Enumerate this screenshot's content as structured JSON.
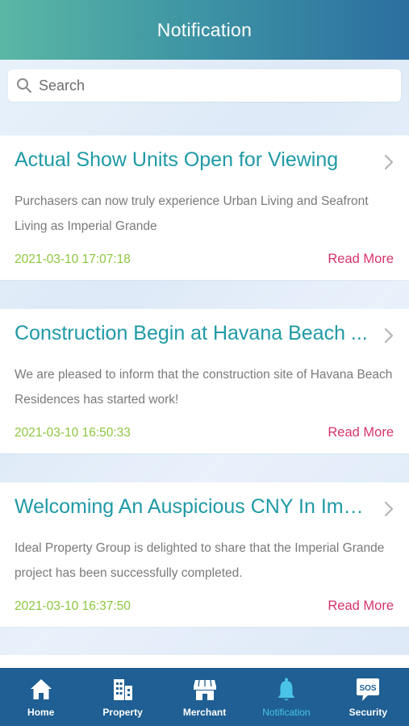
{
  "header": {
    "title": "Notification"
  },
  "search": {
    "placeholder": "Search",
    "icon": "search-icon"
  },
  "notifications": [
    {
      "title": "Actual Show Units Open for Viewing",
      "summary": "Purchasers can now truly experience Urban Living and Seafront Living as Imperial Grande",
      "date": "2021-03-10 17:07:18",
      "action": "Read More"
    },
    {
      "title": "Construction Begin at Havana Beach ...",
      "summary": "We are pleased to inform that the construction site of Havana Beach Residences has started work!",
      "date": "2021-03-10 16:50:33",
      "action": "Read More"
    },
    {
      "title": "Welcoming An Auspicious CNY In Imp...",
      "summary": "Ideal Property Group is delighted to share that the Imperial Grande project has been successfully completed.",
      "date": "2021-03-10 16:37:50",
      "action": "Read More"
    }
  ],
  "tabbar": {
    "items": [
      {
        "label": "Home",
        "icon": "home-icon",
        "active": false
      },
      {
        "label": "Property",
        "icon": "building-icon",
        "active": false
      },
      {
        "label": "Merchant",
        "icon": "shop-icon",
        "active": false
      },
      {
        "label": "Notification",
        "icon": "bell-icon",
        "active": true
      },
      {
        "label": "Security",
        "icon": "sos-icon",
        "active": false
      }
    ]
  },
  "colors": {
    "header_gradient": [
      "#5bb7a5",
      "#2b6fa0"
    ],
    "title": "#1f9aa6",
    "date": "#8cc63f",
    "read_more": "#d6336c",
    "tabbar": "#1f5f93",
    "tab_active": "#49c4e8"
  }
}
